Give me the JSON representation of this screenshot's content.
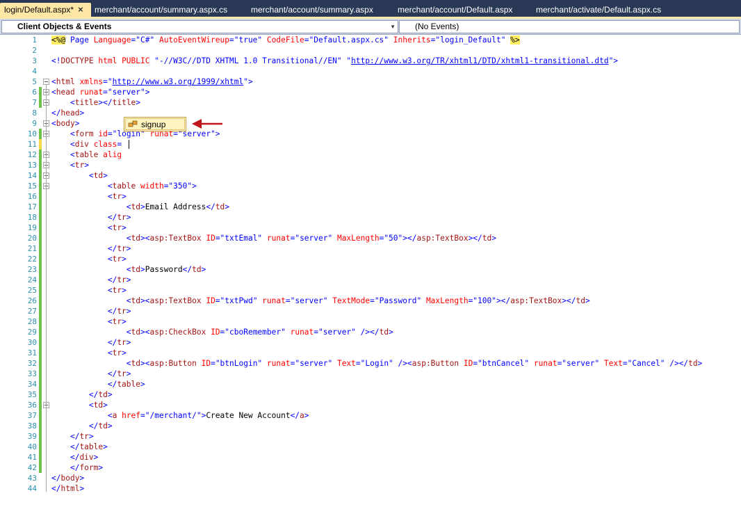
{
  "tabs": [
    {
      "label": "login/Default.aspx*",
      "active": true,
      "close": "×"
    },
    {
      "label": "merchant/account/summary.aspx.cs",
      "active": false
    },
    {
      "label": "merchant/account/summary.aspx",
      "active": false
    },
    {
      "label": "merchant/account/Default.aspx",
      "active": false
    },
    {
      "label": "merchant/activate/Default.aspx.cs",
      "active": false
    }
  ],
  "navbar": {
    "object_combo": "Client Objects & Events",
    "event_combo": "(No Events)"
  },
  "intellisense": {
    "item": "signup",
    "icon": "class-icon"
  },
  "colors": {
    "tab_bar": "#293955",
    "active_tab": "#ffe8a6",
    "line_number": "#2b91af",
    "tag": "#a31515",
    "attribute": "#ff0000",
    "value": "#0000ff",
    "changed_saved": "#6cc24a",
    "changed_unsaved": "#f5d94d"
  },
  "lines": [
    {
      "n": "1",
      "fold": "",
      "chg": "",
      "code": [
        [
          "hl",
          "<%@"
        ],
        [
          "bl",
          " Page "
        ],
        [
          "rd",
          "Language"
        ],
        [
          "bl",
          "=\"C#\" "
        ],
        [
          "rd",
          "AutoEventWireup"
        ],
        [
          "bl",
          "=\"true\" "
        ],
        [
          "rd",
          "CodeFile"
        ],
        [
          "bl",
          "=\"Default.aspx.cs\" "
        ],
        [
          "rd",
          "Inherits"
        ],
        [
          "bl",
          "=\"login_Default\" "
        ],
        [
          "hl",
          "%>"
        ]
      ]
    },
    {
      "n": "2",
      "fold": "",
      "chg": "",
      "code": []
    },
    {
      "n": "3",
      "fold": "",
      "chg": "",
      "code": [
        [
          "bl",
          "<!"
        ],
        [
          "mr",
          "DOCTYPE"
        ],
        [
          "rd",
          " html"
        ],
        [
          "rd",
          " PUBLIC"
        ],
        [
          "bl",
          " \"-//W3C//DTD XHTML 1.0 Transitional//EN\" \""
        ],
        [
          "ul",
          "http://www.w3.org/TR/xhtml1/DTD/xhtml1-transitional.dtd"
        ],
        [
          "bl",
          "\">"
        ]
      ]
    },
    {
      "n": "4",
      "fold": "",
      "chg": "",
      "code": []
    },
    {
      "n": "5",
      "fold": "open",
      "chg": "",
      "code": [
        [
          "bl",
          "<"
        ],
        [
          "mr",
          "html"
        ],
        [
          "rd",
          " xmlns"
        ],
        [
          "bl",
          "=\""
        ],
        [
          "ul",
          "http://www.w3.org/1999/xhtml"
        ],
        [
          "bl",
          "\">"
        ]
      ]
    },
    {
      "n": "6",
      "fold": "open",
      "chg": "g",
      "code": [
        [
          "bl",
          "<"
        ],
        [
          "mr",
          "head"
        ],
        [
          "rd",
          " runat"
        ],
        [
          "bl",
          "=\"server\">"
        ]
      ]
    },
    {
      "n": "7",
      "fold": "open",
      "chg": "g",
      "code": [
        [
          "",
          "    "
        ],
        [
          "bl",
          "<"
        ],
        [
          "mr",
          "title"
        ],
        [
          "bl",
          "></"
        ],
        [
          "mr",
          "title"
        ],
        [
          "bl",
          ">"
        ]
      ]
    },
    {
      "n": "8",
      "fold": "",
      "chg": "",
      "code": [
        [
          "bl",
          "</"
        ],
        [
          "mr",
          "head"
        ],
        [
          "bl",
          ">"
        ]
      ]
    },
    {
      "n": "9",
      "fold": "open",
      "chg": "",
      "code": [
        [
          "bl",
          "<"
        ],
        [
          "mr",
          "body"
        ],
        [
          "bl",
          ">"
        ]
      ]
    },
    {
      "n": "10",
      "fold": "open",
      "chg": "g",
      "code": [
        [
          "",
          "    "
        ],
        [
          "bl",
          "<"
        ],
        [
          "mr",
          "form"
        ],
        [
          "rd",
          " id"
        ],
        [
          "bl",
          "=\"login\" "
        ],
        [
          "rd",
          "runat"
        ],
        [
          "bl",
          "=\"server\">"
        ]
      ]
    },
    {
      "n": "11",
      "fold": "",
      "chg": "y",
      "code": [
        [
          "",
          "    "
        ],
        [
          "bl",
          "<"
        ],
        [
          "mr",
          "div"
        ],
        [
          "rd",
          " class"
        ],
        [
          "bl",
          "="
        ]
      ]
    },
    {
      "n": "12",
      "fold": "open",
      "chg": "g",
      "code": [
        [
          "",
          "    "
        ],
        [
          "bl",
          "<"
        ],
        [
          "mr",
          "table"
        ],
        [
          "rd",
          " alig"
        ]
      ]
    },
    {
      "n": "13",
      "fold": "open",
      "chg": "g",
      "code": [
        [
          "",
          "    "
        ],
        [
          "bl",
          "<"
        ],
        [
          "mr",
          "tr"
        ],
        [
          "bl",
          ">"
        ]
      ]
    },
    {
      "n": "14",
      "fold": "open",
      "chg": "g",
      "code": [
        [
          "",
          "        "
        ],
        [
          "bl",
          "<"
        ],
        [
          "mr",
          "td"
        ],
        [
          "bl",
          ">"
        ]
      ]
    },
    {
      "n": "15",
      "fold": "open",
      "chg": "g",
      "code": [
        [
          "",
          "            "
        ],
        [
          "bl",
          "<"
        ],
        [
          "mr",
          "table"
        ],
        [
          "rd",
          " width"
        ],
        [
          "bl",
          "=\"350\">"
        ]
      ]
    },
    {
      "n": "16",
      "fold": "",
      "chg": "g",
      "code": [
        [
          "",
          "            "
        ],
        [
          "bl",
          "<"
        ],
        [
          "mr",
          "tr"
        ],
        [
          "bl",
          ">"
        ]
      ]
    },
    {
      "n": "17",
      "fold": "",
      "chg": "g",
      "code": [
        [
          "",
          "                "
        ],
        [
          "bl",
          "<"
        ],
        [
          "mr",
          "td"
        ],
        [
          "bl",
          ">"
        ],
        [
          "",
          "Email Address"
        ],
        [
          "bl",
          "</"
        ],
        [
          "mr",
          "td"
        ],
        [
          "bl",
          ">"
        ]
      ]
    },
    {
      "n": "18",
      "fold": "",
      "chg": "g",
      "code": [
        [
          "",
          "            "
        ],
        [
          "bl",
          "</"
        ],
        [
          "mr",
          "tr"
        ],
        [
          "bl",
          ">"
        ]
      ]
    },
    {
      "n": "19",
      "fold": "",
      "chg": "g",
      "code": [
        [
          "",
          "            "
        ],
        [
          "bl",
          "<"
        ],
        [
          "mr",
          "tr"
        ],
        [
          "bl",
          ">"
        ]
      ]
    },
    {
      "n": "20",
      "fold": "",
      "chg": "g",
      "code": [
        [
          "",
          "                "
        ],
        [
          "bl",
          "<"
        ],
        [
          "mr",
          "td"
        ],
        [
          "bl",
          "><"
        ],
        [
          "mr",
          "asp:TextBox"
        ],
        [
          "rd",
          " ID"
        ],
        [
          "bl",
          "=\"txtEmal\" "
        ],
        [
          "rd",
          "runat"
        ],
        [
          "bl",
          "=\"server\" "
        ],
        [
          "rd",
          "MaxLength"
        ],
        [
          "bl",
          "=\"50\"></"
        ],
        [
          "mr",
          "asp:TextBox"
        ],
        [
          "bl",
          "></"
        ],
        [
          "mr",
          "td"
        ],
        [
          "bl",
          ">"
        ]
      ]
    },
    {
      "n": "21",
      "fold": "",
      "chg": "g",
      "code": [
        [
          "",
          "            "
        ],
        [
          "bl",
          "</"
        ],
        [
          "mr",
          "tr"
        ],
        [
          "bl",
          ">"
        ]
      ]
    },
    {
      "n": "22",
      "fold": "",
      "chg": "g",
      "code": [
        [
          "",
          "            "
        ],
        [
          "bl",
          "<"
        ],
        [
          "mr",
          "tr"
        ],
        [
          "bl",
          ">"
        ]
      ]
    },
    {
      "n": "23",
      "fold": "",
      "chg": "g",
      "code": [
        [
          "",
          "                "
        ],
        [
          "bl",
          "<"
        ],
        [
          "mr",
          "td"
        ],
        [
          "bl",
          ">"
        ],
        [
          "",
          "Password"
        ],
        [
          "bl",
          "</"
        ],
        [
          "mr",
          "td"
        ],
        [
          "bl",
          ">"
        ]
      ]
    },
    {
      "n": "24",
      "fold": "",
      "chg": "g",
      "code": [
        [
          "",
          "            "
        ],
        [
          "bl",
          "</"
        ],
        [
          "mr",
          "tr"
        ],
        [
          "bl",
          ">"
        ]
      ]
    },
    {
      "n": "25",
      "fold": "",
      "chg": "g",
      "code": [
        [
          "",
          "            "
        ],
        [
          "bl",
          "<"
        ],
        [
          "mr",
          "tr"
        ],
        [
          "bl",
          ">"
        ]
      ]
    },
    {
      "n": "26",
      "fold": "",
      "chg": "g",
      "code": [
        [
          "",
          "                "
        ],
        [
          "bl",
          "<"
        ],
        [
          "mr",
          "td"
        ],
        [
          "bl",
          "><"
        ],
        [
          "mr",
          "asp:TextBox"
        ],
        [
          "rd",
          " ID"
        ],
        [
          "bl",
          "=\"txtPwd\" "
        ],
        [
          "rd",
          "runat"
        ],
        [
          "bl",
          "=\"server\" "
        ],
        [
          "rd",
          "TextMode"
        ],
        [
          "bl",
          "=\"Password\" "
        ],
        [
          "rd",
          "MaxLength"
        ],
        [
          "bl",
          "=\"100\"></"
        ],
        [
          "mr",
          "asp:TextBox"
        ],
        [
          "bl",
          "></"
        ],
        [
          "mr",
          "td"
        ],
        [
          "bl",
          ">"
        ]
      ]
    },
    {
      "n": "27",
      "fold": "",
      "chg": "g",
      "code": [
        [
          "",
          "            "
        ],
        [
          "bl",
          "</"
        ],
        [
          "mr",
          "tr"
        ],
        [
          "bl",
          ">"
        ]
      ]
    },
    {
      "n": "28",
      "fold": "",
      "chg": "g",
      "code": [
        [
          "",
          "            "
        ],
        [
          "bl",
          "<"
        ],
        [
          "mr",
          "tr"
        ],
        [
          "bl",
          ">"
        ]
      ]
    },
    {
      "n": "29",
      "fold": "",
      "chg": "g",
      "code": [
        [
          "",
          "                "
        ],
        [
          "bl",
          "<"
        ],
        [
          "mr",
          "td"
        ],
        [
          "bl",
          "><"
        ],
        [
          "mr",
          "asp:CheckBox"
        ],
        [
          "rd",
          " ID"
        ],
        [
          "bl",
          "=\"cboRemember\" "
        ],
        [
          "rd",
          "runat"
        ],
        [
          "bl",
          "=\"server\" /></"
        ],
        [
          "mr",
          "td"
        ],
        [
          "bl",
          ">"
        ]
      ]
    },
    {
      "n": "30",
      "fold": "",
      "chg": "g",
      "code": [
        [
          "",
          "            "
        ],
        [
          "bl",
          "</"
        ],
        [
          "mr",
          "tr"
        ],
        [
          "bl",
          ">"
        ]
      ]
    },
    {
      "n": "31",
      "fold": "",
      "chg": "g",
      "code": [
        [
          "",
          "            "
        ],
        [
          "bl",
          "<"
        ],
        [
          "mr",
          "tr"
        ],
        [
          "bl",
          ">"
        ]
      ]
    },
    {
      "n": "32",
      "fold": "",
      "chg": "g",
      "code": [
        [
          "",
          "                "
        ],
        [
          "bl",
          "<"
        ],
        [
          "mr",
          "td"
        ],
        [
          "bl",
          "><"
        ],
        [
          "mr",
          "asp:Button"
        ],
        [
          "rd",
          " ID"
        ],
        [
          "bl",
          "=\"btnLogin\" "
        ],
        [
          "rd",
          "runat"
        ],
        [
          "bl",
          "=\"server\" "
        ],
        [
          "rd",
          "Text"
        ],
        [
          "bl",
          "=\"Login\" /><"
        ],
        [
          "mr",
          "asp:Button"
        ],
        [
          "rd",
          " ID"
        ],
        [
          "bl",
          "=\"btnCancel\" "
        ],
        [
          "rd",
          "runat"
        ],
        [
          "bl",
          "=\"server\" "
        ],
        [
          "rd",
          "Text"
        ],
        [
          "bl",
          "=\"Cancel\" /></"
        ],
        [
          "mr",
          "td"
        ],
        [
          "bl",
          ">"
        ]
      ]
    },
    {
      "n": "33",
      "fold": "",
      "chg": "g",
      "code": [
        [
          "",
          "            "
        ],
        [
          "bl",
          "</"
        ],
        [
          "mr",
          "tr"
        ],
        [
          "bl",
          ">"
        ]
      ]
    },
    {
      "n": "34",
      "fold": "",
      "chg": "g",
      "code": [
        [
          "",
          "            "
        ],
        [
          "bl",
          "</"
        ],
        [
          "mr",
          "table"
        ],
        [
          "bl",
          ">"
        ]
      ]
    },
    {
      "n": "35",
      "fold": "",
      "chg": "g",
      "code": [
        [
          "",
          "        "
        ],
        [
          "bl",
          "</"
        ],
        [
          "mr",
          "td"
        ],
        [
          "bl",
          ">"
        ]
      ]
    },
    {
      "n": "36",
      "fold": "open",
      "chg": "g",
      "code": [
        [
          "",
          "        "
        ],
        [
          "bl",
          "<"
        ],
        [
          "mr",
          "td"
        ],
        [
          "bl",
          ">"
        ]
      ]
    },
    {
      "n": "37",
      "fold": "",
      "chg": "g",
      "code": [
        [
          "",
          "            "
        ],
        [
          "bl",
          "<"
        ],
        [
          "mr",
          "a"
        ],
        [
          "rd",
          " href"
        ],
        [
          "bl",
          "=\"/merchant/\">"
        ],
        [
          "",
          "Create New Account"
        ],
        [
          "bl",
          "</"
        ],
        [
          "mr",
          "a"
        ],
        [
          "bl",
          ">"
        ]
      ]
    },
    {
      "n": "38",
      "fold": "",
      "chg": "g",
      "code": [
        [
          "",
          "        "
        ],
        [
          "bl",
          "</"
        ],
        [
          "mr",
          "td"
        ],
        [
          "bl",
          ">"
        ]
      ]
    },
    {
      "n": "39",
      "fold": "",
      "chg": "g",
      "code": [
        [
          "",
          "    "
        ],
        [
          "bl",
          "</"
        ],
        [
          "mr",
          "tr"
        ],
        [
          "bl",
          ">"
        ]
      ]
    },
    {
      "n": "40",
      "fold": "",
      "chg": "g",
      "code": [
        [
          "",
          "    "
        ],
        [
          "bl",
          "</"
        ],
        [
          "mr",
          "table"
        ],
        [
          "bl",
          ">"
        ]
      ]
    },
    {
      "n": "41",
      "fold": "",
      "chg": "g",
      "code": [
        [
          "",
          "    "
        ],
        [
          "bl",
          "</"
        ],
        [
          "mr",
          "div"
        ],
        [
          "bl",
          ">"
        ]
      ]
    },
    {
      "n": "42",
      "fold": "",
      "chg": "g",
      "code": [
        [
          "",
          "    "
        ],
        [
          "bl",
          "</"
        ],
        [
          "mr",
          "form"
        ],
        [
          "bl",
          ">"
        ]
      ]
    },
    {
      "n": "43",
      "fold": "",
      "chg": "",
      "code": [
        [
          "bl",
          "</"
        ],
        [
          "mr",
          "body"
        ],
        [
          "bl",
          ">"
        ]
      ]
    },
    {
      "n": "44",
      "fold": "",
      "chg": "",
      "code": [
        [
          "bl",
          "</"
        ],
        [
          "mr",
          "html"
        ],
        [
          "bl",
          ">"
        ]
      ]
    }
  ]
}
